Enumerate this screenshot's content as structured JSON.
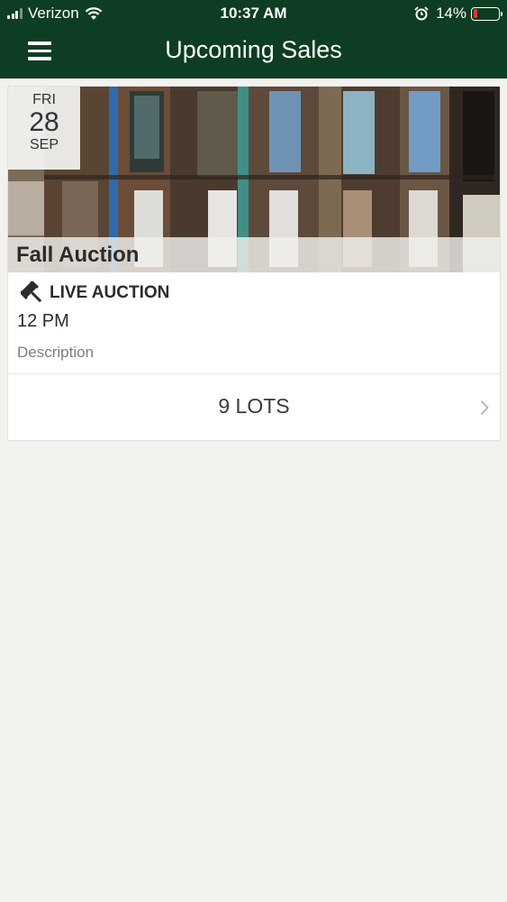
{
  "status_bar": {
    "carrier": "Verizon",
    "time": "10:37 AM",
    "battery": "14%",
    "battery_level": 0.14,
    "icons": [
      "signal-icon",
      "wifi-icon",
      "alarm-icon",
      "battery-icon"
    ]
  },
  "header": {
    "title": "Upcoming Sales",
    "menu_icon": "hamburger-menu-icon",
    "background_color": "#0d3d22"
  },
  "sales": [
    {
      "date": {
        "weekday": "FRI",
        "day": "28",
        "month": "SEP"
      },
      "title": "Fall Auction",
      "type": "LIVE AUCTION",
      "type_icon": "gavel-icon",
      "time": "12 PM",
      "description": "Description",
      "lots": "9 LOTS",
      "lots_icon": "chevron-right-icon"
    }
  ],
  "colors": {
    "page_background": "#f3f2ef",
    "battery_low": "#e8322c"
  }
}
